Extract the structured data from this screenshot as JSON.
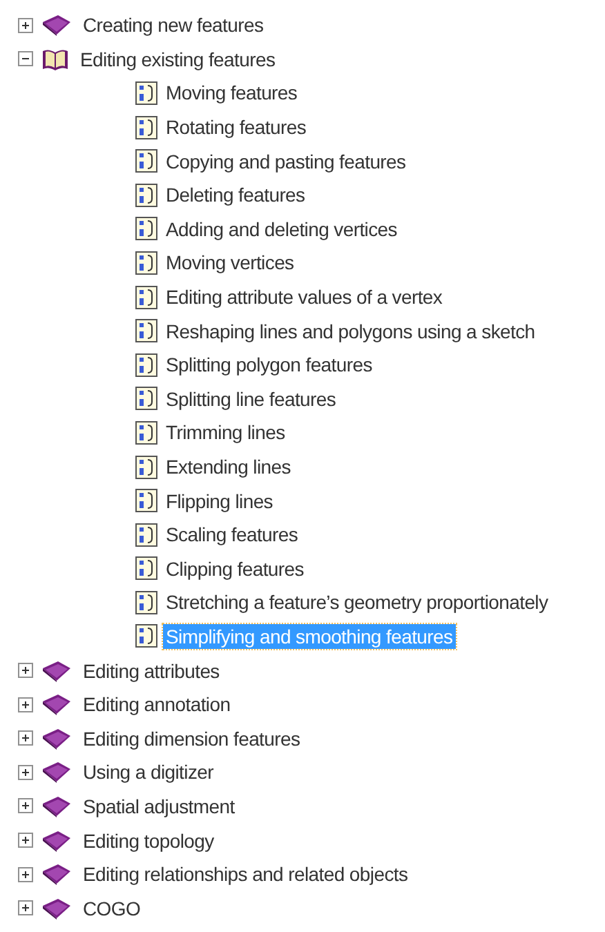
{
  "tree": [
    {
      "kind": "book",
      "label": "Creating new features",
      "expanded": false,
      "selected": false
    },
    {
      "kind": "book",
      "label": "Editing existing features",
      "expanded": true,
      "selected": false,
      "children": [
        {
          "kind": "page",
          "label": "Moving features",
          "selected": false
        },
        {
          "kind": "page",
          "label": "Rotating features",
          "selected": false
        },
        {
          "kind": "page",
          "label": "Copying and pasting features",
          "selected": false
        },
        {
          "kind": "page",
          "label": "Deleting features",
          "selected": false
        },
        {
          "kind": "page",
          "label": "Adding and deleting vertices",
          "selected": false
        },
        {
          "kind": "page",
          "label": "Moving vertices",
          "selected": false
        },
        {
          "kind": "page",
          "label": "Editing attribute values of a vertex",
          "selected": false
        },
        {
          "kind": "page",
          "label": "Reshaping lines and polygons using a sketch",
          "selected": false
        },
        {
          "kind": "page",
          "label": "Splitting polygon features",
          "selected": false
        },
        {
          "kind": "page",
          "label": "Splitting line features",
          "selected": false
        },
        {
          "kind": "page",
          "label": "Trimming lines",
          "selected": false
        },
        {
          "kind": "page",
          "label": "Extending lines",
          "selected": false
        },
        {
          "kind": "page",
          "label": "Flipping lines",
          "selected": false
        },
        {
          "kind": "page",
          "label": "Scaling features",
          "selected": false
        },
        {
          "kind": "page",
          "label": "Clipping features",
          "selected": false
        },
        {
          "kind": "page",
          "label": "Stretching a feature’s geometry proportionately",
          "selected": false
        },
        {
          "kind": "page",
          "label": "Simplifying and smoothing features",
          "selected": true
        }
      ]
    },
    {
      "kind": "book",
      "label": "Editing attributes",
      "expanded": false,
      "selected": false
    },
    {
      "kind": "book",
      "label": "Editing annotation",
      "expanded": false,
      "selected": false
    },
    {
      "kind": "book",
      "label": "Editing dimension features",
      "expanded": false,
      "selected": false
    },
    {
      "kind": "book",
      "label": "Using a digitizer",
      "expanded": false,
      "selected": false
    },
    {
      "kind": "book",
      "label": "Spatial adjustment",
      "expanded": false,
      "selected": false
    },
    {
      "kind": "book",
      "label": "Editing topology",
      "expanded": false,
      "selected": false
    },
    {
      "kind": "book",
      "label": "Editing relationships and related objects",
      "expanded": false,
      "selected": false
    },
    {
      "kind": "book",
      "label": "COGO",
      "expanded": false,
      "selected": false
    }
  ]
}
